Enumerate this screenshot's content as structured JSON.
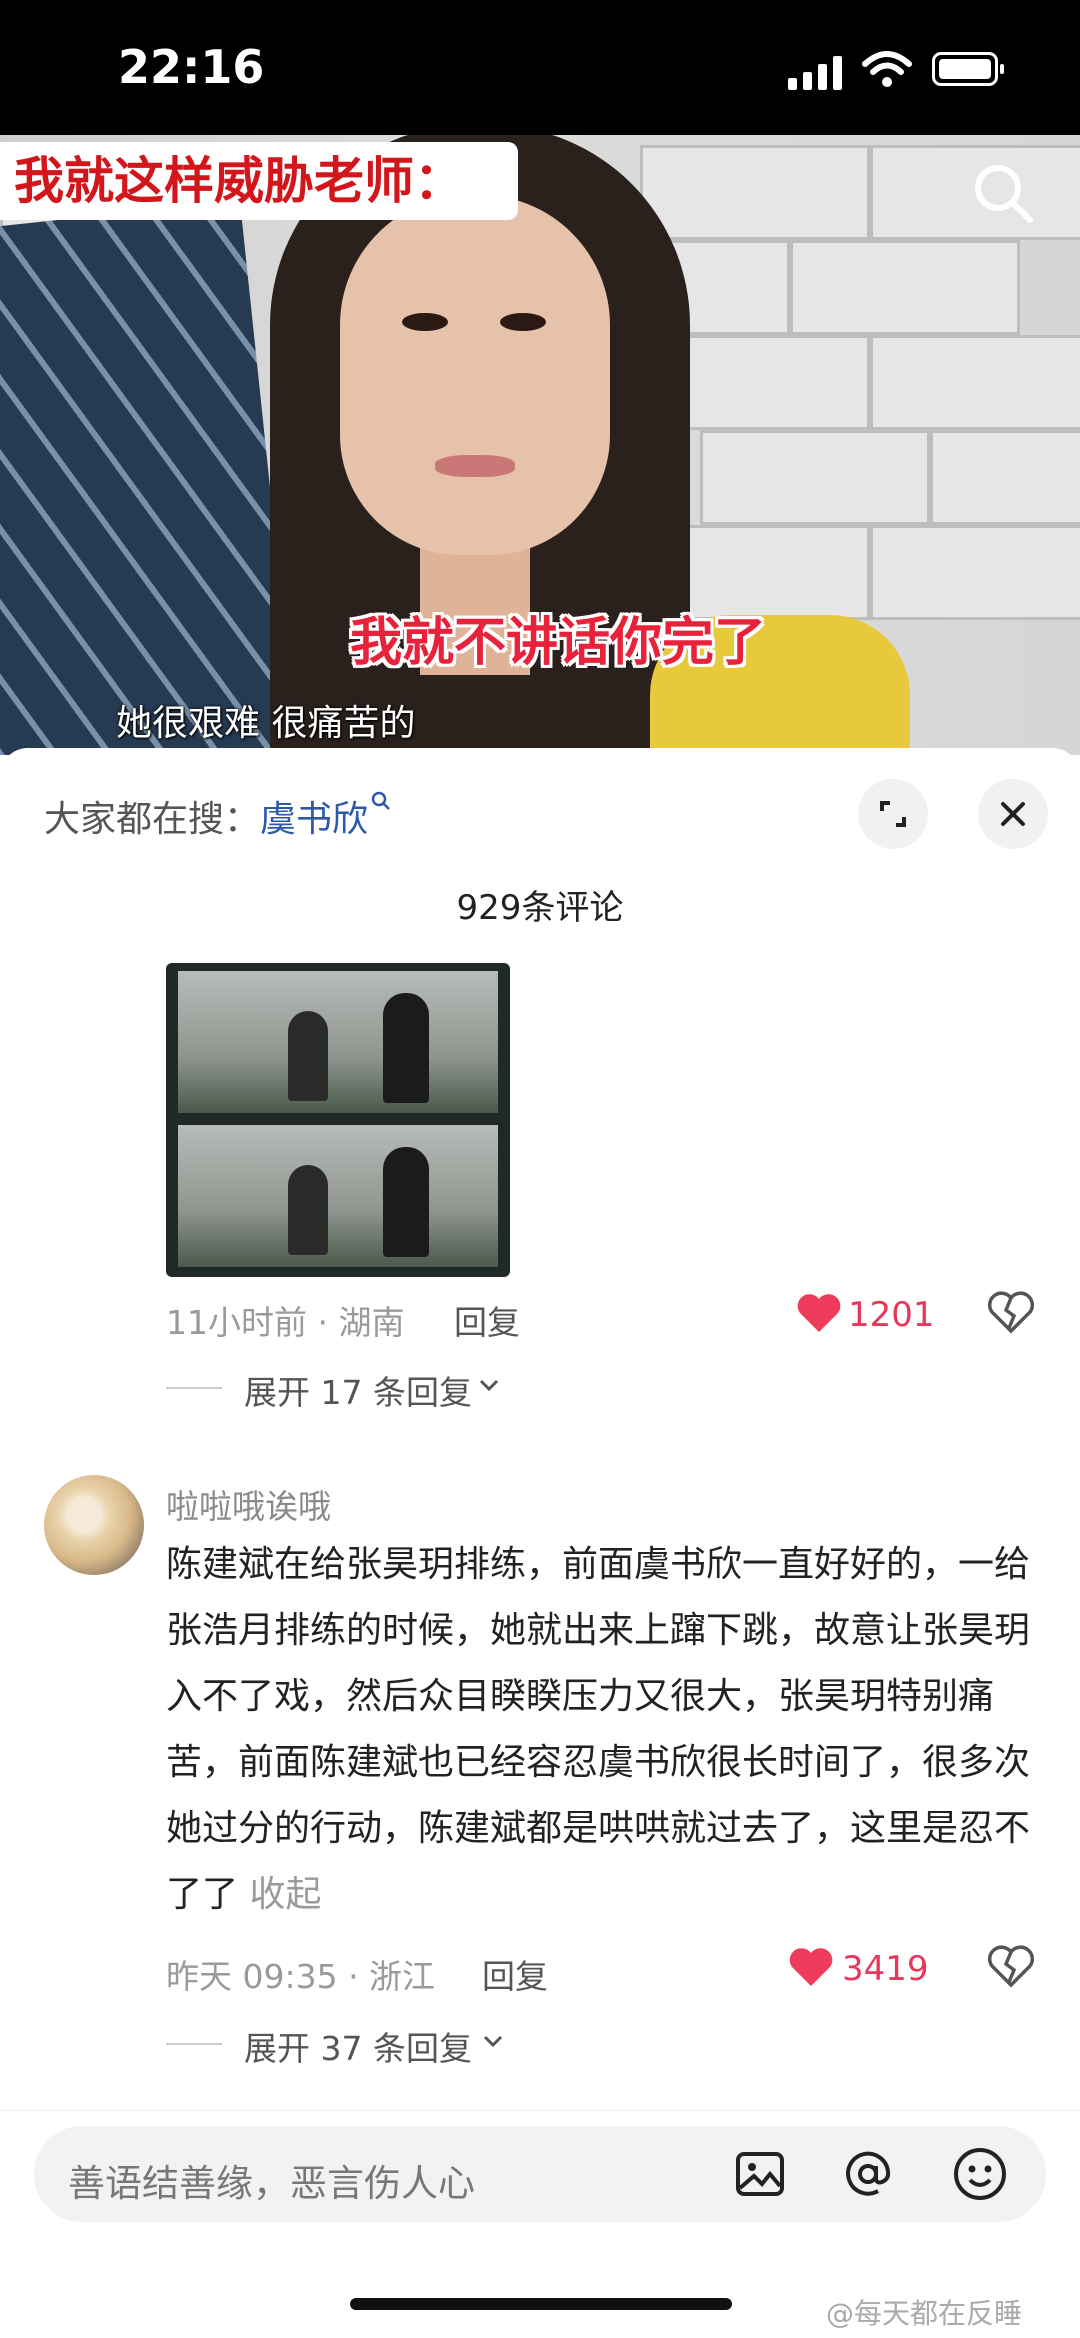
{
  "status_bar": {
    "time": "22:16"
  },
  "video": {
    "top_caption": "我就这样威胁老师：",
    "subtitle_red": "我就不讲话你完了",
    "subtitle_white": "她很艰难 很痛苦的"
  },
  "panel": {
    "hot_search_prefix": "大家都在搜：",
    "hot_search_keyword": "虞书欣",
    "comment_count": "929条评论"
  },
  "comment1": {
    "meta": "11小时前 · 湖南",
    "reply_label": "回复",
    "likes": "1201",
    "expand_label": "展开 17 条回复"
  },
  "comment2": {
    "username": "啦啦哦诶哦",
    "text": "陈建斌在给张昊玥排练，前面虞书欣一直好好的，一给张浩月排练的时候，她就出来上蹿下跳，故意让张昊玥入不了戏，然后众目睽睽压力又很大，张昊玥特别痛苦，前面陈建斌也已经容忍虞书欣很长时间了，很多次她过分的行动，陈建斌都是哄哄就过去了，这里是忍不了了",
    "collapse_label": "收起",
    "meta": "昨天 09:35 · 浙江",
    "reply_label": "回复",
    "likes": "3419",
    "expand_label": "展开 37 条回复"
  },
  "input": {
    "placeholder": "善语结善缘，恶言伤人心"
  },
  "watermark": "@每天都在反睡"
}
